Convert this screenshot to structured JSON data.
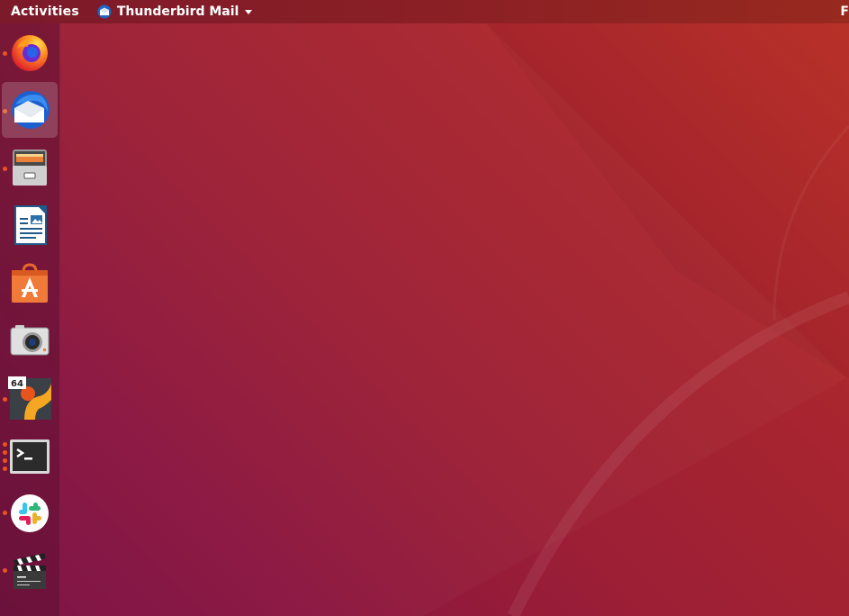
{
  "topbar": {
    "activities_label": "Activities",
    "app_menu": {
      "label": "Thunderbird Mail",
      "icon": "thunderbird-icon"
    },
    "right_partial_label": "F"
  },
  "dock": {
    "items": [
      {
        "name": "Firefox Web Browser",
        "icon": "firefox-icon",
        "running_windows": 1,
        "active": false
      },
      {
        "name": "Thunderbird Mail",
        "icon": "thunderbird-icon",
        "running_windows": 1,
        "active": true
      },
      {
        "name": "Files",
        "icon": "file-cabinet-icon",
        "running_windows": 1,
        "active": false
      },
      {
        "name": "LibreOffice Writer",
        "icon": "libreoffice-writer-icon",
        "running_windows": 0,
        "active": false
      },
      {
        "name": "Ubuntu Software",
        "icon": "software-bag-icon",
        "running_windows": 0,
        "active": false
      },
      {
        "name": "Camera",
        "icon": "camera-icon",
        "running_windows": 0,
        "active": false
      },
      {
        "name": "VLC/Emulator 64",
        "icon": "app-64-icon",
        "badge": "64",
        "running_windows": 1,
        "active": false
      },
      {
        "name": "Terminal",
        "icon": "terminal-icon",
        "running_windows": 4,
        "active": false
      },
      {
        "name": "Slack",
        "icon": "slack-icon",
        "running_windows": 1,
        "active": false
      },
      {
        "name": "Video Editor",
        "icon": "clapperboard-icon",
        "running_windows": 1,
        "active": false
      }
    ]
  },
  "colors": {
    "accent": "#e95420",
    "topbar": "#88201f",
    "wallpaper_top_right": "#c0342a",
    "wallpaper_bottom_left": "#7a0f42"
  }
}
